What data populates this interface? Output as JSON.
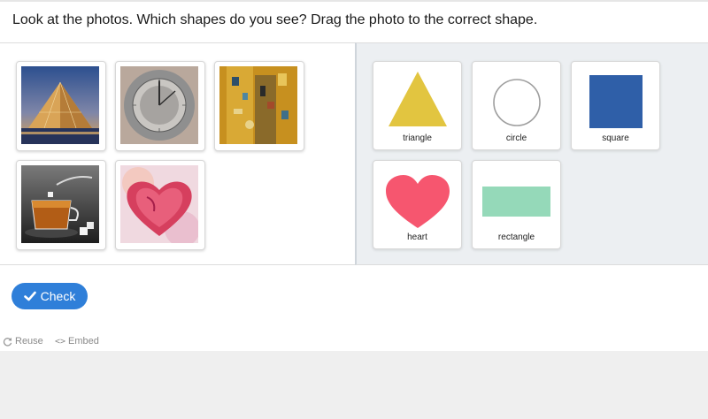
{
  "question": "Look at the photos. Which shapes do you see? Drag the photo to the correct shape.",
  "photos": [
    {
      "name": "pyramid-photo"
    },
    {
      "name": "sundial-photo"
    },
    {
      "name": "klimt-painting-photo"
    },
    {
      "name": "tea-cup-photo"
    },
    {
      "name": "heart-painting-photo"
    }
  ],
  "shapes": [
    {
      "label": "triangle",
      "color": "#e2c540"
    },
    {
      "label": "circle",
      "color": "#9e9e9e"
    },
    {
      "label": "square",
      "color": "#2f5fa8"
    },
    {
      "label": "heart",
      "color": "#f6566f"
    },
    {
      "label": "rectangle",
      "color": "#95d9b9"
    }
  ],
  "check_button": {
    "label": "Check",
    "color": "#2f7fd9"
  },
  "footer": {
    "reuse_label": "Reuse",
    "embed_label": "Embed",
    "embed_icon": "<>"
  }
}
